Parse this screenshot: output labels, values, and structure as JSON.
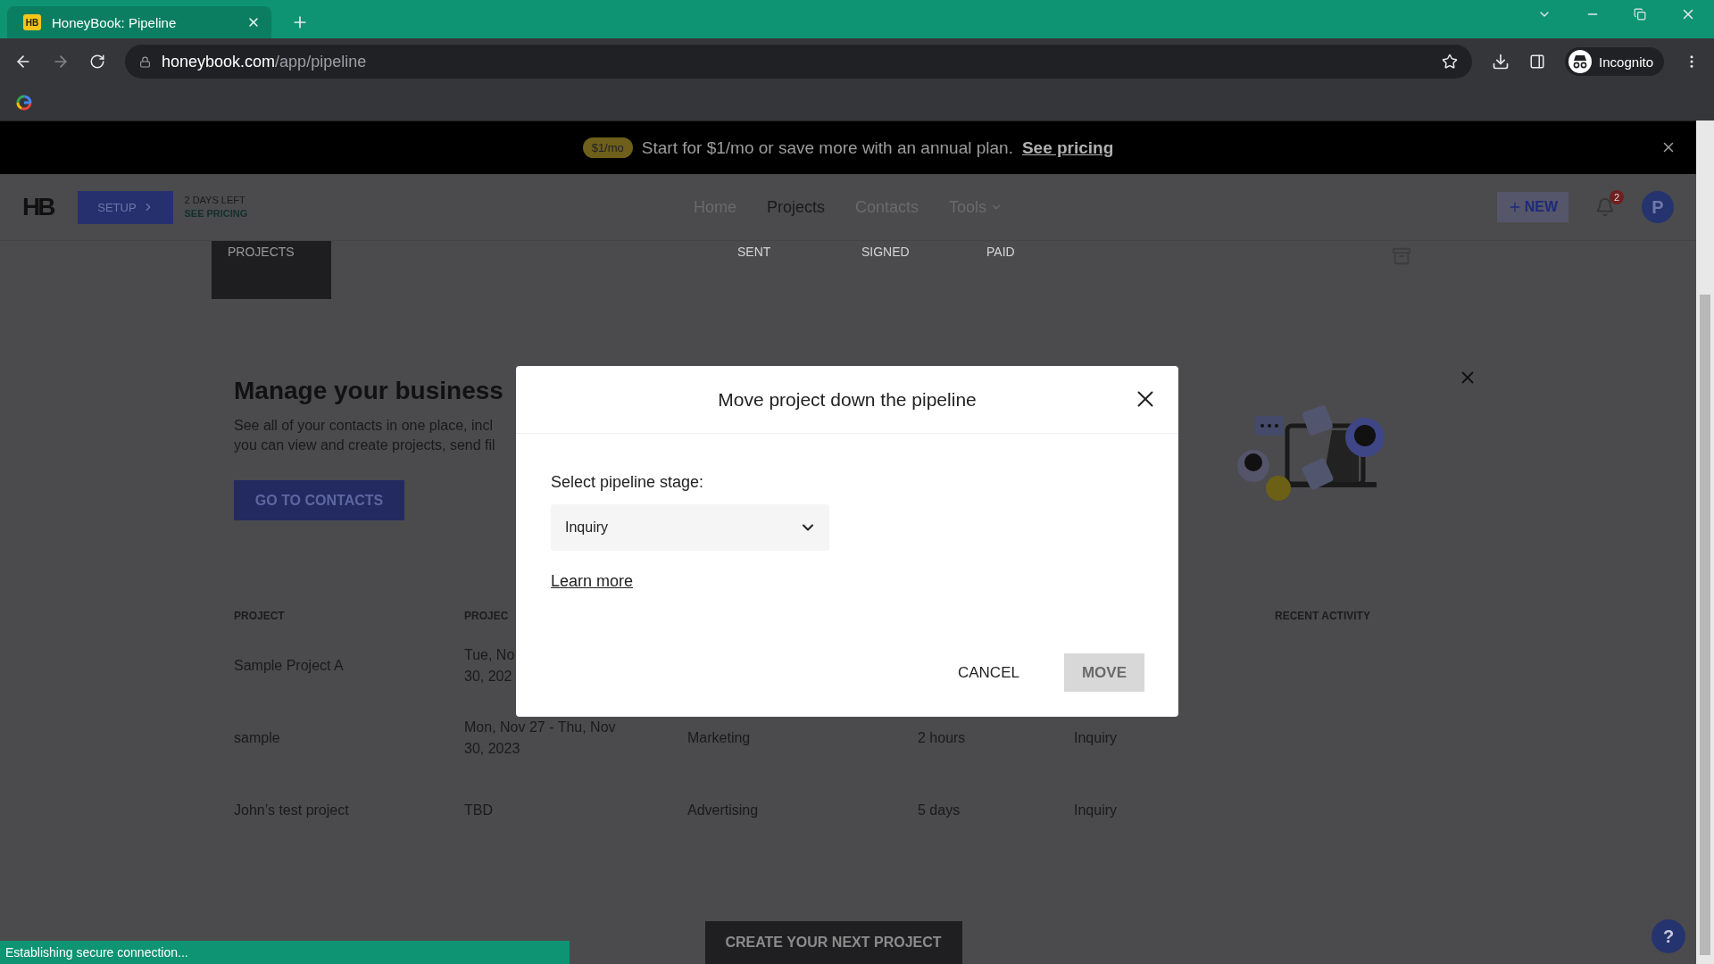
{
  "browser": {
    "tab": {
      "favicon": "HB",
      "title": "HoneyBook: Pipeline"
    },
    "url_domain": "honeybook.com",
    "url_path": "/app/pipeline",
    "profile": "Incognito"
  },
  "banner": {
    "badge": "$1/mo",
    "text": "Start for $1/mo or save more with an annual plan.",
    "link": "See pricing"
  },
  "nav": {
    "logo": "HB",
    "setup": "SETUP",
    "trial": [
      "2 DAYS LEFT",
      "SEE PRICING"
    ],
    "links": [
      {
        "label": "Home",
        "selected": false,
        "kind": "link"
      },
      {
        "label": "Projects",
        "selected": true,
        "kind": "link"
      },
      {
        "label": "Contacts",
        "selected": false,
        "kind": "link"
      },
      {
        "label": "Tools",
        "selected": false,
        "kind": "menu"
      }
    ],
    "new_button": "NEW",
    "notifications": "2",
    "avatar": "P"
  },
  "stage_tabs": [
    {
      "label": "PROJECTS",
      "selected": true
    },
    {
      "label": "SENT",
      "selected": false
    },
    {
      "label": "SIGNED",
      "selected": false
    },
    {
      "label": "PAID",
      "selected": false
    }
  ],
  "promo": {
    "title": "Manage your business",
    "lines": [
      "See all of your contacts in one place, incl",
      "you can view and create projects, send fil"
    ],
    "button": "GO TO CONTACTS"
  },
  "table": {
    "columns": {
      "project": "PROJECT",
      "date": "PROJEC",
      "recent_activity": "RECENT ACTIVITY"
    },
    "rows": [
      {
        "project": "Sample Project A",
        "date": [
          "Tue, No",
          "30, 202"
        ]
      },
      {
        "project": "sample",
        "date": [
          "Mon, Nov 27 - Thu, Nov",
          "30, 2023"
        ],
        "type": "Marketing",
        "age": "2 hours",
        "stage": "Inquiry"
      },
      {
        "project": "John’s test project",
        "date": [
          "TBD"
        ],
        "type": "Advertising",
        "age": "5 days",
        "stage": "Inquiry"
      }
    ]
  },
  "create_button": "CREATE YOUR NEXT PROJECT",
  "help": "?",
  "status": "Establishing secure connection...",
  "modal": {
    "title": "Move project down the pipeline",
    "label": "Select pipeline stage:",
    "select": {
      "value": "Inquiry"
    },
    "link": "Learn more",
    "buttons": [
      {
        "label": "CANCEL",
        "disabled": false
      },
      {
        "label": "MOVE",
        "disabled": true
      }
    ]
  }
}
